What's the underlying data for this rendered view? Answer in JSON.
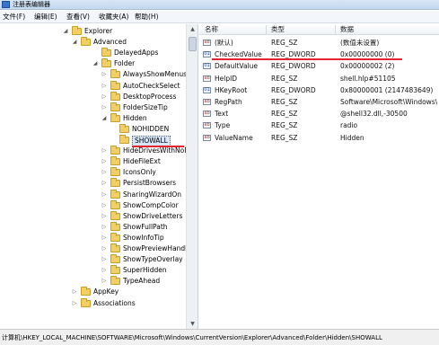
{
  "window": {
    "title": "注册表编辑器"
  },
  "menu": {
    "items": [
      "文件(F)",
      "编辑(E)",
      "查看(V)",
      "收藏夹(A)",
      "帮助(H)"
    ]
  },
  "tree": {
    "items": [
      {
        "label": "Explorer",
        "expander": "◢"
      },
      {
        "label": "Advanced",
        "expander": "◢"
      },
      {
        "label": "DelayedApps",
        "expander": ""
      },
      {
        "label": "Folder",
        "expander": "◢"
      },
      {
        "label": "AlwaysShowMenus",
        "expander": "▷"
      },
      {
        "label": "AutoCheckSelect",
        "expander": "▷"
      },
      {
        "label": "DesktopProcess",
        "expander": "▷"
      },
      {
        "label": "FolderSizeTip",
        "expander": "▷"
      },
      {
        "label": "Hidden",
        "expander": "◢"
      },
      {
        "label": "NOHIDDEN",
        "expander": ""
      },
      {
        "label": "SHOWALL",
        "expander": "",
        "selected": true
      },
      {
        "label": "HideDrivesWithNoM",
        "expander": "▷"
      },
      {
        "label": "HideFileExt",
        "expander": "▷"
      },
      {
        "label": "IconsOnly",
        "expander": "▷"
      },
      {
        "label": "PersistBrowsers",
        "expander": "▷"
      },
      {
        "label": "SharingWizardOn",
        "expander": "▷"
      },
      {
        "label": "ShowCompColor",
        "expander": "▷"
      },
      {
        "label": "ShowDriveLetters",
        "expander": "▷"
      },
      {
        "label": "ShowFullPath",
        "expander": "▷"
      },
      {
        "label": "ShowInfoTip",
        "expander": "▷"
      },
      {
        "label": "ShowPreviewHandle",
        "expander": "▷"
      },
      {
        "label": "ShowTypeOverlay",
        "expander": "▷"
      },
      {
        "label": "SuperHidden",
        "expander": "▷"
      },
      {
        "label": "TypeAhead",
        "expander": "▷"
      },
      {
        "label": "AppKey",
        "expander": "▷"
      },
      {
        "label": "Associations",
        "expander": "▷"
      }
    ]
  },
  "list": {
    "columns": {
      "name": "名称",
      "type": "类型",
      "data": "数据"
    },
    "rows": [
      {
        "name": "(默认)",
        "type": "REG_SZ",
        "data": "(数值未设置)",
        "icon": "ab"
      },
      {
        "name": "CheckedValue",
        "type": "REG_DWORD",
        "data": "0x00000000 (0)",
        "icon": "01"
      },
      {
        "name": "DefaultValue",
        "type": "REG_DWORD",
        "data": "0x00000002 (2)",
        "icon": "01"
      },
      {
        "name": "HelpID",
        "type": "REG_SZ",
        "data": "shell.hlp#51105",
        "icon": "ab"
      },
      {
        "name": "HKeyRoot",
        "type": "REG_DWORD",
        "data": "0x80000001 (2147483649)",
        "icon": "01"
      },
      {
        "name": "RegPath",
        "type": "REG_SZ",
        "data": "Software\\Microsoft\\Windows\\",
        "icon": "ab"
      },
      {
        "name": "Text",
        "type": "REG_SZ",
        "data": "@shell32.dll,-30500",
        "icon": "ab"
      },
      {
        "name": "Type",
        "type": "REG_SZ",
        "data": "radio",
        "icon": "ab"
      },
      {
        "name": "ValueName",
        "type": "REG_SZ",
        "data": "Hidden",
        "icon": "ab"
      }
    ]
  },
  "status": {
    "path": "计算机\\HKEY_LOCAL_MACHINE\\SOFTWARE\\Microsoft\\Windows\\CurrentVersion\\Explorer\\Advanced\\Folder\\Hidden\\SHOWALL"
  },
  "colors": {
    "annotation": "#e3262e",
    "selection": "#d6e6f7"
  }
}
